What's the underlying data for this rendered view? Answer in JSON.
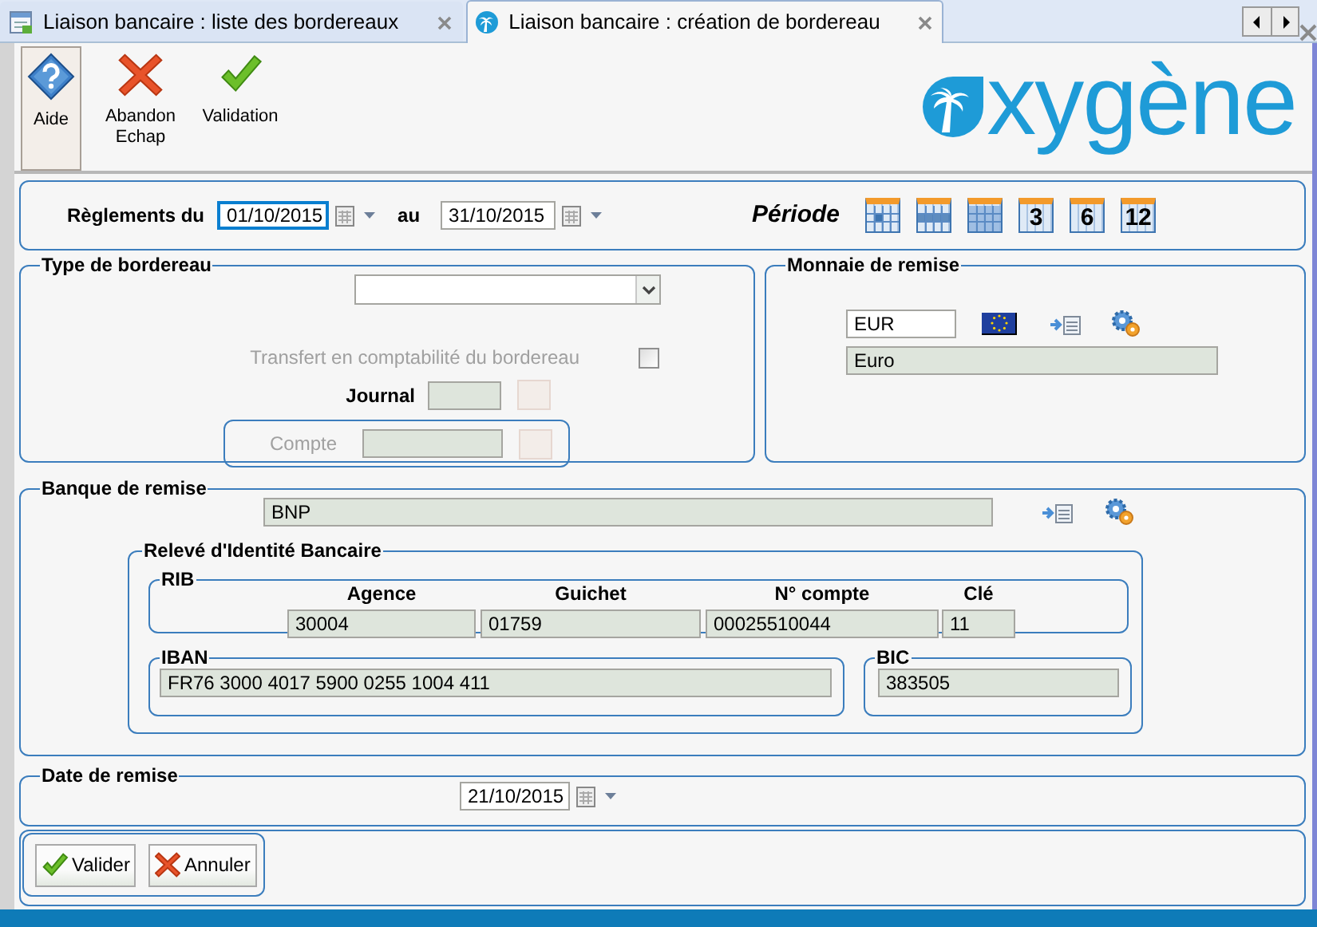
{
  "tabs": [
    {
      "label": "Liaison bancaire : liste des bordereaux",
      "kind": "list",
      "selected": false
    },
    {
      "label": "Liaison bancaire : création de bordereau",
      "kind": "logo",
      "selected": true
    }
  ],
  "toolbar": [
    {
      "lines": [
        "Aide"
      ],
      "kind": "help",
      "selected": true
    },
    {
      "lines": [
        "Abandon",
        "Echap"
      ],
      "kind": "cancel",
      "selected": false
    },
    {
      "lines": [
        "Validation"
      ],
      "kind": "ok",
      "selected": false
    }
  ],
  "logo": {
    "text": "xygène"
  },
  "period": {
    "label_from": "Règlements du",
    "from": "01/10/2015",
    "from_focused": true,
    "label_to": "au",
    "to": "31/10/2015",
    "title": "Période",
    "presets": [
      {
        "kind": "day"
      },
      {
        "kind": "week"
      },
      {
        "kind": "month"
      },
      {
        "kind": "count",
        "label": "3"
      },
      {
        "kind": "count",
        "label": "6"
      },
      {
        "kind": "count",
        "label": "12"
      }
    ]
  },
  "type_bordereau": {
    "title": "Type de bordereau",
    "transfer": {
      "label": "Transfert en comptabilité du bordereau",
      "checked": false,
      "disabled": true
    },
    "journal": {
      "label": "Journal"
    },
    "compte": {
      "label": "Compte",
      "disabled": true
    }
  },
  "monnaie": {
    "title": "Monnaie de remise",
    "code": "EUR",
    "name": "Euro"
  },
  "banque": {
    "title": "Banque de remise",
    "name": "BNP",
    "rib_block": "Relevé d'Identité Bancaire",
    "rib": {
      "title": "RIB",
      "fields": [
        {
          "label": "Agence",
          "value": "30004"
        },
        {
          "label": "Guichet",
          "value": "01759"
        },
        {
          "label": "N° compte",
          "value": "00025510044"
        },
        {
          "label": "Clé",
          "value": "11"
        }
      ]
    },
    "iban": {
      "title": "IBAN",
      "value": "FR76  3000  4017  5900  0255  1004  411"
    },
    "bic": {
      "title": "BIC",
      "value": "383505"
    }
  },
  "date_remise": {
    "title": "Date de remise",
    "value": "21/10/2015"
  },
  "buttons": [
    {
      "label": "Valider",
      "kind": "ok"
    },
    {
      "label": "Annuler",
      "kind": "cancel"
    }
  ]
}
